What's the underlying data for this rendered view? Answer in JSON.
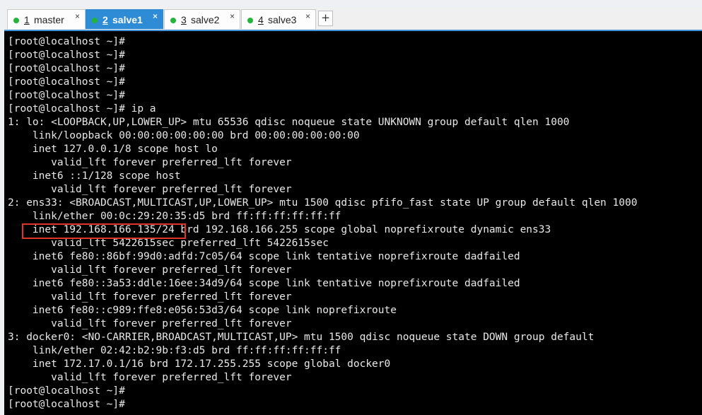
{
  "tabs": [
    {
      "number": "1",
      "label": "master",
      "active": false,
      "status_color": "#23b43a",
      "close_icon": "×"
    },
    {
      "number": "2",
      "label": "salve1",
      "active": true,
      "status_color": "#23b43a",
      "close_icon": "×"
    },
    {
      "number": "3",
      "label": "salve2",
      "active": false,
      "status_color": "#23b43a",
      "close_icon": "×"
    },
    {
      "number": "4",
      "label": "salve3",
      "active": false,
      "status_color": "#23b43a",
      "close_icon": "×"
    }
  ],
  "add_tab_label": "+",
  "terminal": {
    "lines": [
      "[root@localhost ~]#",
      "[root@localhost ~]#",
      "[root@localhost ~]#",
      "[root@localhost ~]#",
      "[root@localhost ~]#",
      "[root@localhost ~]# ip a",
      "1: lo: <LOOPBACK,UP,LOWER_UP> mtu 65536 qdisc noqueue state UNKNOWN group default qlen 1000",
      "    link/loopback 00:00:00:00:00:00 brd 00:00:00:00:00:00",
      "    inet 127.0.0.1/8 scope host lo",
      "       valid_lft forever preferred_lft forever",
      "    inet6 ::1/128 scope host",
      "       valid_lft forever preferred_lft forever",
      "2: ens33: <BROADCAST,MULTICAST,UP,LOWER_UP> mtu 1500 qdisc pfifo_fast state UP group default qlen 1000",
      "    link/ether 00:0c:29:20:35:d5 brd ff:ff:ff:ff:ff:ff",
      "    inet 192.168.166.135/24 brd 192.168.166.255 scope global noprefixroute dynamic ens33",
      "       valid_lft 5422615sec preferred_lft 5422615sec",
      "    inet6 fe80::86bf:99d0:adfd:7c05/64 scope link tentative noprefixroute dadfailed",
      "       valid_lft forever preferred_lft forever",
      "    inet6 fe80::3a53:ddle:16ee:34d9/64 scope link tentative noprefixroute dadfailed",
      "       valid_lft forever preferred_lft forever",
      "    inet6 fe80::c989:ffe8:e056:53d3/64 scope link noprefixroute",
      "       valid_lft forever preferred_lft forever",
      "3: docker0: <NO-CARRIER,BROADCAST,MULTICAST,UP> mtu 1500 qdisc noqueue state DOWN group default",
      "    link/ether 02:42:b2:9b:f3:d5 brd ff:ff:ff:ff:ff:ff",
      "    inet 172.17.0.1/16 brd 172.17.255.255 scope global docker0",
      "       valid_lft forever preferred_lft forever",
      "[root@localhost ~]#",
      "[root@localhost ~]#"
    ],
    "background_color": "#000000",
    "text_color": "#e8e8e8",
    "highlight_color": "#e0342a"
  }
}
